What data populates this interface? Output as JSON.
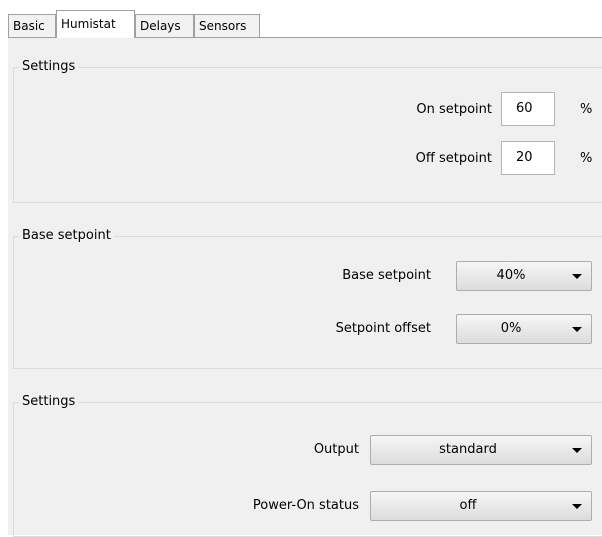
{
  "tabs": [
    {
      "label": "Basic",
      "active": false
    },
    {
      "label": "Humistat",
      "active": true
    },
    {
      "label": "Delays",
      "active": false
    },
    {
      "label": "Sensors",
      "active": false
    }
  ],
  "settings_group": {
    "title": "Settings",
    "on_setpoint": {
      "label": "On setpoint",
      "value": "60",
      "unit": "%"
    },
    "off_setpoint": {
      "label": "Off setpoint",
      "value": "20",
      "unit": "%"
    }
  },
  "base_setpoint_group": {
    "title": "Base setpoint",
    "base_setpoint": {
      "label": "Base setpoint",
      "value": "40%"
    },
    "setpoint_offset": {
      "label": "Setpoint offset",
      "value": "0%"
    }
  },
  "output_group": {
    "title": "Settings",
    "output": {
      "label": "Output",
      "value": "standard"
    },
    "power_on_status": {
      "label": "Power-On status",
      "value": "off"
    }
  }
}
